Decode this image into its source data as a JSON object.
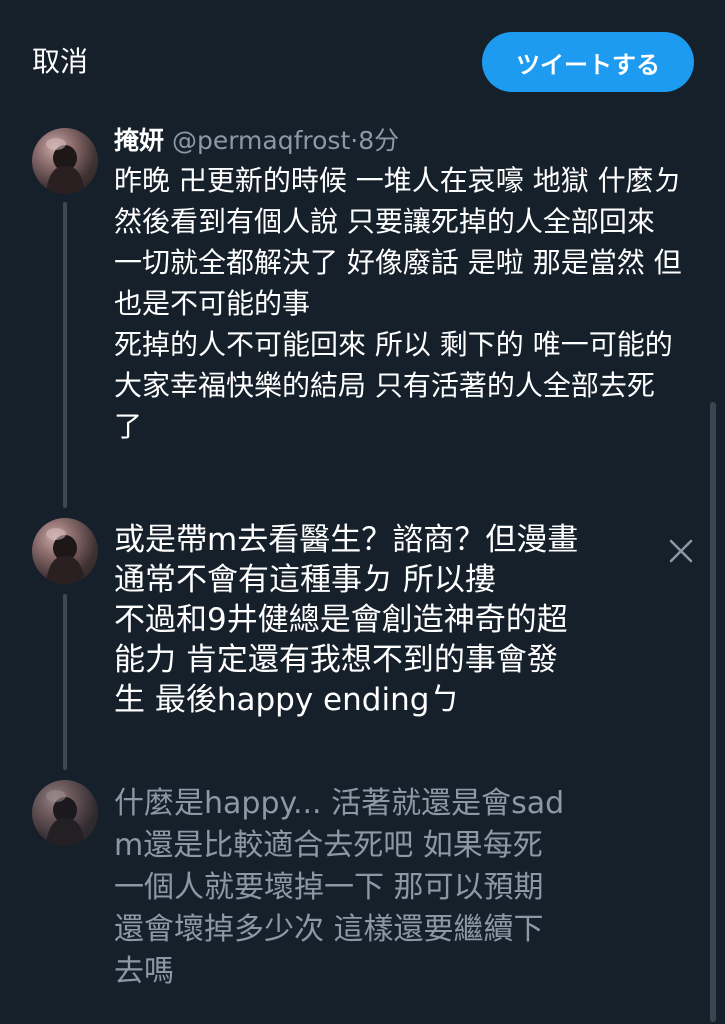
{
  "topbar": {
    "cancel_label": "取消",
    "tweet_label": "ツイートする",
    "accent_color": "#1d9bf0"
  },
  "original_tweet": {
    "author_name": "掩妍",
    "handle": "@permaqfrost",
    "separator": "·",
    "time": "8分",
    "lines": [
      "昨晚 卍更新的時候 一堆人在哀嚎 地獄 什麼ㄉ",
      "然後看到有個人說 只要讓死掉的人全部回來",
      "一切就全都解決了 好像廢話 是啦 那是當然 但",
      "也是不可能的事",
      "死掉的人不可能回來 所以 剩下的 唯一可能的",
      "大家幸福快樂的結局 只有活著的人全部去死",
      "了"
    ]
  },
  "draft_tweet_1": {
    "lines": [
      "或是帶m去看醫生？諮商？但漫畫",
      "通常不會有這種事ㄉ 所以摟",
      "不過和9井健總是會創造神奇的超",
      "能力 肯定還有我想不到的事會發",
      "生 最後happy endingㄅ"
    ]
  },
  "draft_tweet_2": {
    "lines": [
      "什麼是happy... 活著就還是會sad",
      "m還是比較適合去死吧 如果每死",
      "一個人就要壞掉一下 那可以預期",
      "還會壞掉多少次 這樣還要繼續下",
      "去嗎"
    ]
  },
  "icons": {
    "remove": "close-icon",
    "avatar": "avatar-image"
  }
}
